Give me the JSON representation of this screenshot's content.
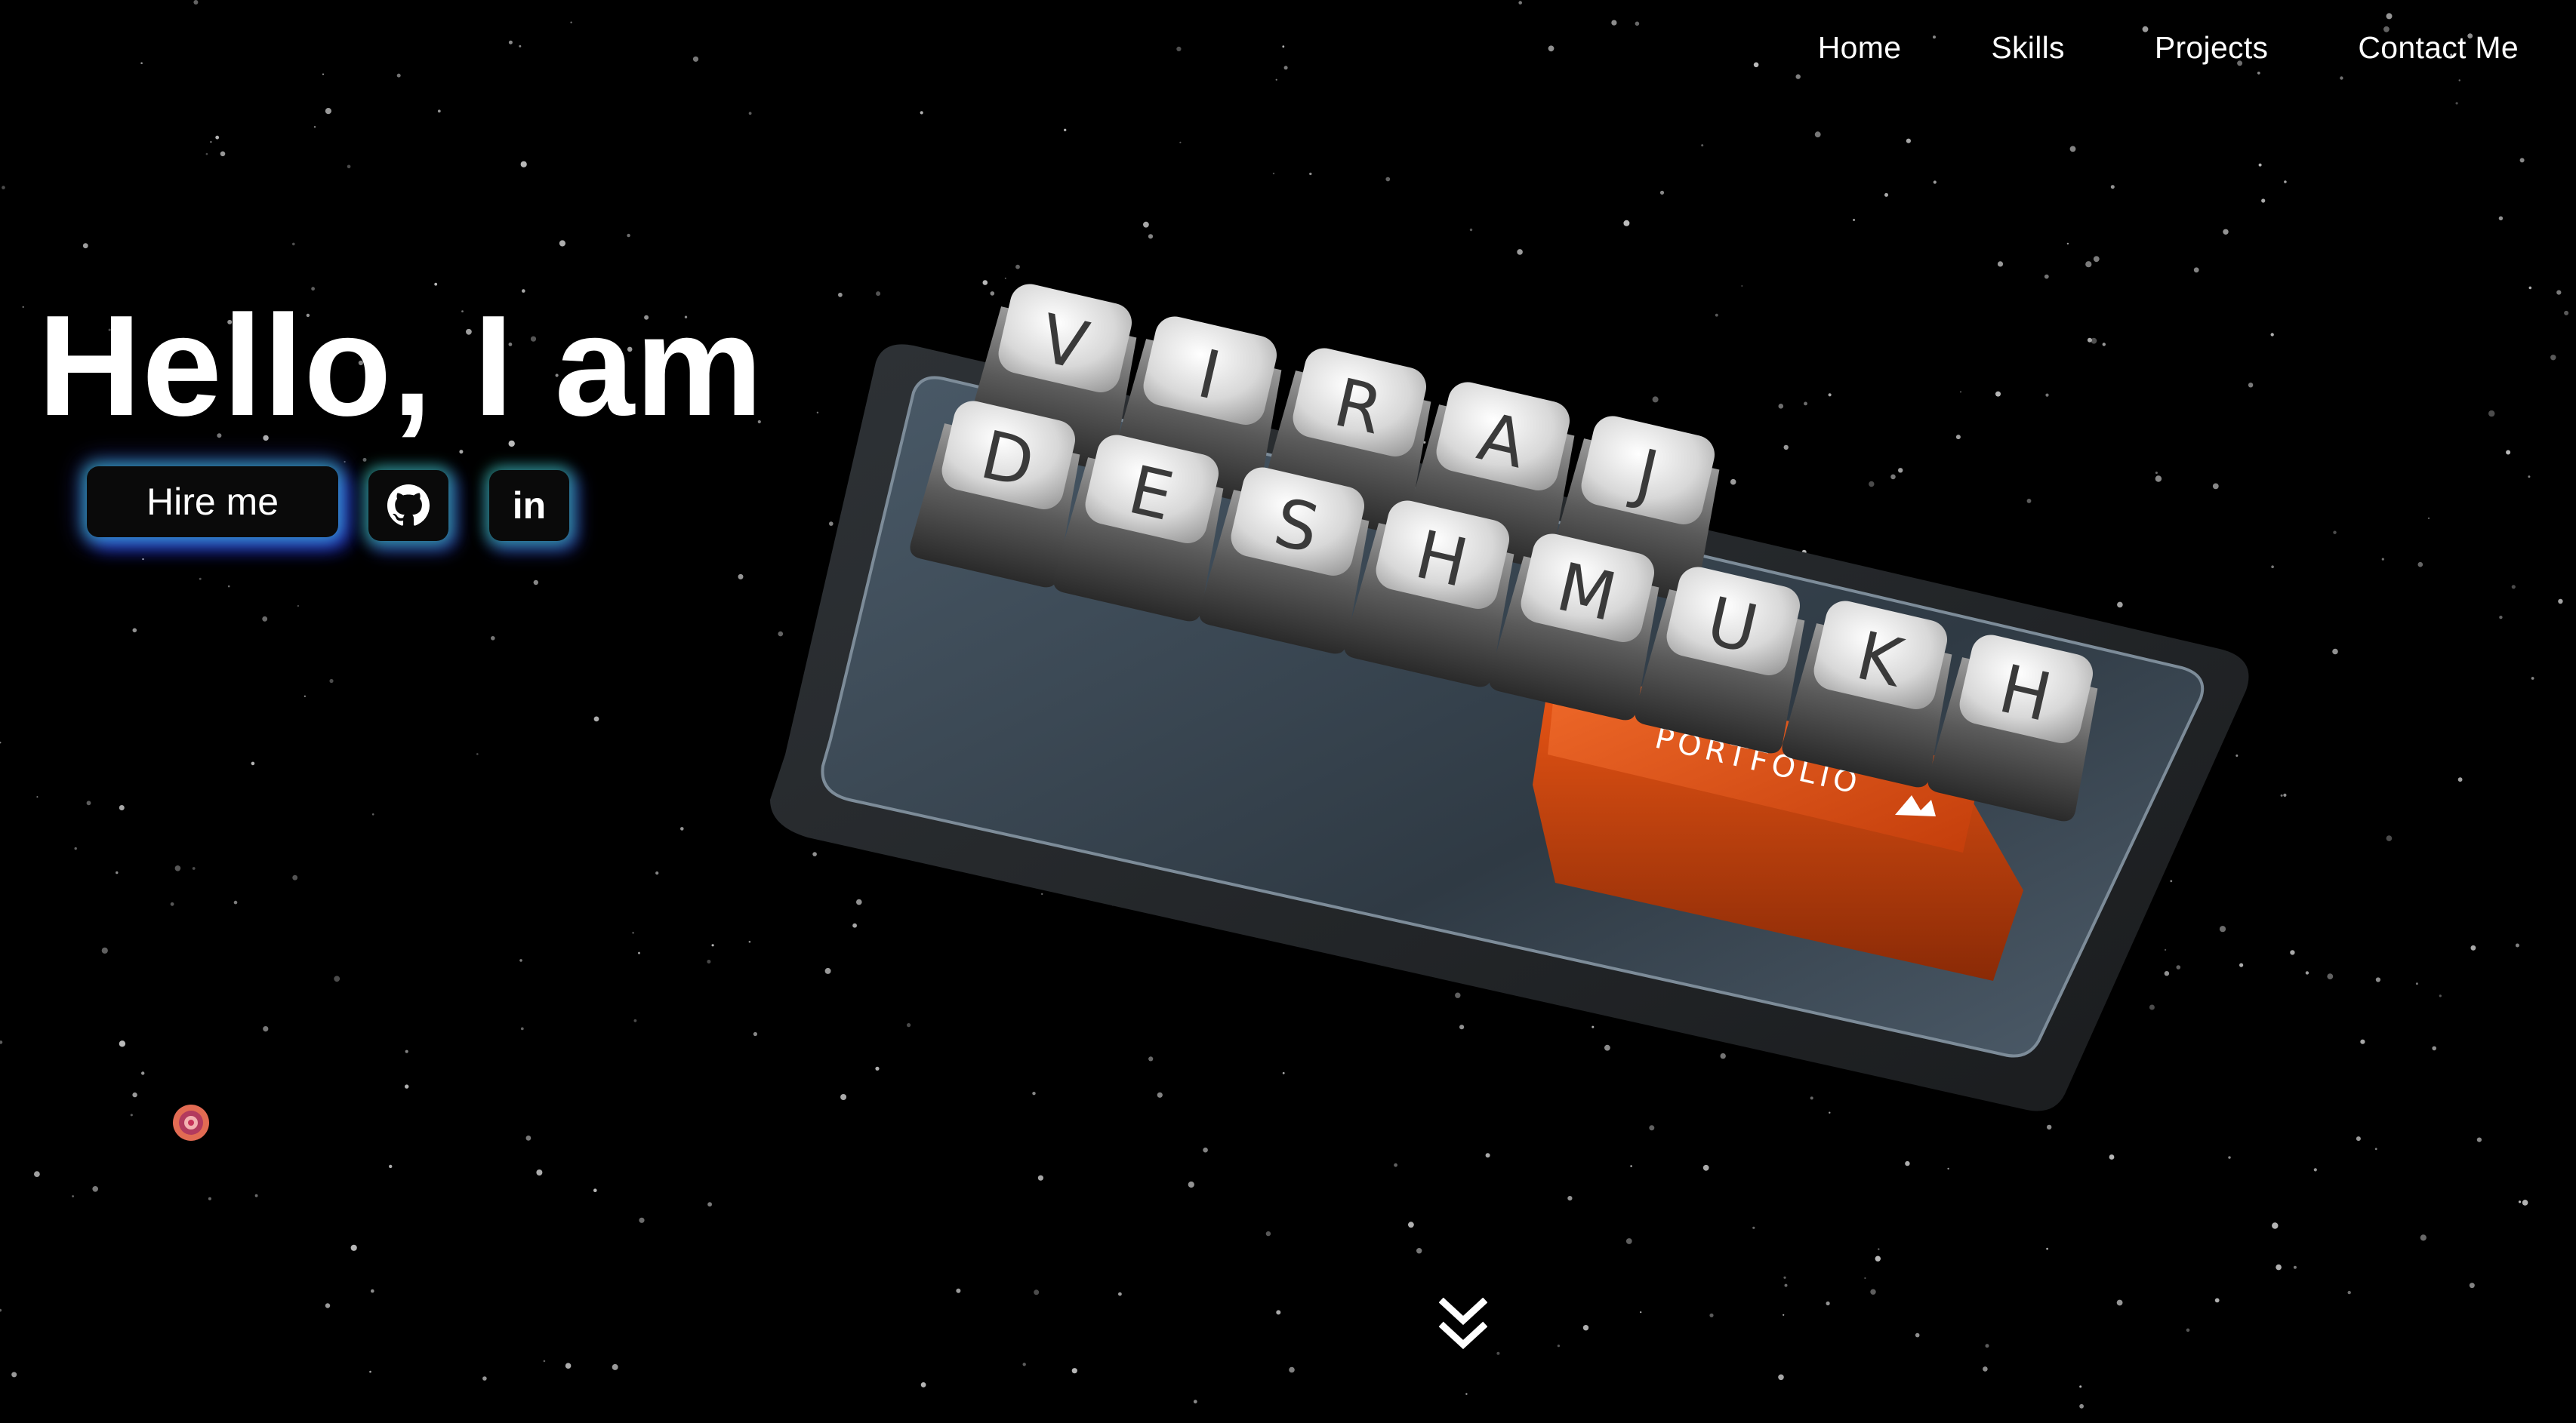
{
  "nav": {
    "items": [
      "Home",
      "Skills",
      "Projects",
      "Contact Me"
    ]
  },
  "hero": {
    "title": "Hello, I am",
    "hire_label": "Hire me",
    "github_icon": "github-icon",
    "linkedin_label": "in"
  },
  "keyboard": {
    "row1": [
      "V",
      "I",
      "R",
      "A",
      "J"
    ],
    "row2": [
      "D",
      "E",
      "S",
      "H",
      "M",
      "U",
      "K",
      "H"
    ],
    "spacebar_label": "PORTFOLIO"
  },
  "colors": {
    "background": "#000000",
    "accent_orange": "#e0430f",
    "glow_teal": "#3cdcc8",
    "glow_blue": "#4650ff"
  },
  "icons": {
    "scroll": "double-chevron-down-icon",
    "target": "target-icon"
  }
}
